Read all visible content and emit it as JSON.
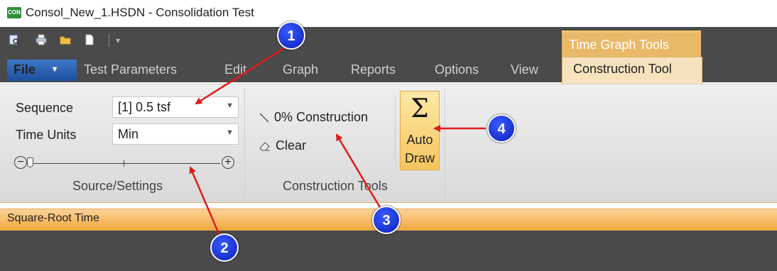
{
  "window": {
    "title": "Consol_New_1.HSDN - Consolidation Test",
    "app_logo_text": "CON"
  },
  "quick_access": {
    "icons": [
      "preview-icon",
      "print-icon",
      "open-folder-icon",
      "new-document-icon"
    ],
    "customize_glyph": "▾"
  },
  "ribbon": {
    "file_label": "File",
    "file_caret": "▾",
    "tabs": [
      "Test Parameters",
      "Edit",
      "Graph",
      "Reports",
      "Options",
      "View"
    ],
    "contextual_header": "Time Graph Tools",
    "active_tab": "Construction Tool"
  },
  "source_settings": {
    "sequence_label": "Sequence",
    "sequence_value": "[1]  0.5 tsf",
    "time_units_label": "Time Units",
    "time_units_value": "Min",
    "zoom_out_glyph": "−",
    "zoom_in_glyph": "+",
    "slider_value": 0,
    "group_label": "Source/Settings"
  },
  "construction_tools": {
    "construction_label": "0% Construction",
    "clear_label": "Clear",
    "auto_draw_glyph": "Σ",
    "auto_draw_line1": "Auto",
    "auto_draw_line2": "Draw",
    "group_label": "Construction Tools"
  },
  "status": {
    "graph_mode": "Square-Root Time"
  },
  "callouts": [
    "1",
    "2",
    "3",
    "4"
  ],
  "colors": {
    "ribbon_dark": "#4a4a4a",
    "contextual_orange": "#e9b96a",
    "active_tab_bg": "#f6e3be",
    "callout_blue": "#0a1fb8",
    "arrow_red": "#e01b1b",
    "file_blue": "#2a62b8"
  }
}
